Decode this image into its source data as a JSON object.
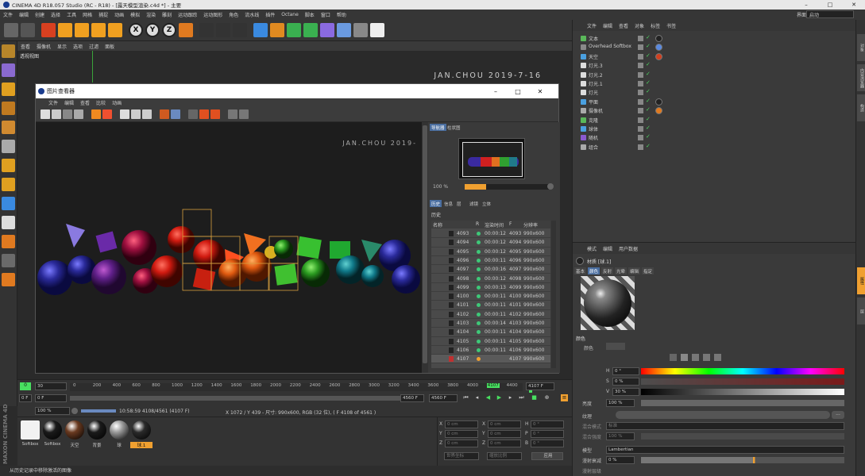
{
  "window": {
    "title": "CINEMA 4D R18.057 Studio (RC - R18) - [露天模型渲染.c4d *] - 主要",
    "minimize": "–",
    "maximize": "□",
    "close": "✕"
  },
  "menubar": {
    "items": [
      "文件",
      "编辑",
      "创建",
      "选择",
      "工具",
      "网格",
      "捕捉",
      "动画",
      "模拟",
      "渲染",
      "雕刻",
      "运动跟踪",
      "运动图形",
      "角色",
      "流水线",
      "插件",
      "Octane",
      "脚本",
      "窗口",
      "帮助"
    ],
    "layout_label": "界面:",
    "layout_value": "启动"
  },
  "toolbar": {
    "icons": [
      "undo-icon",
      "redo-icon",
      "select-icon",
      "move-icon",
      "scale-icon",
      "rotate-icon",
      "live-select-icon",
      "x-axis-icon",
      "y-axis-icon",
      "z-axis-icon",
      "coordinate-icon",
      "render-region-icon",
      "render-view-icon",
      "render-settings-icon",
      "cube-icon",
      "pen-icon",
      "subdivide-icon",
      "array-icon",
      "deformer-icon",
      "floor-icon",
      "camera-icon",
      "light-icon"
    ],
    "axis_x": "X",
    "axis_y": "Y",
    "axis_z": "Z"
  },
  "viewport": {
    "menu": [
      "查看",
      "摄像机",
      "显示",
      "选项",
      "过滤",
      "面板"
    ],
    "label": "透视视图",
    "watermark": "JAN.CHOU 2019-7-16"
  },
  "picture_viewer": {
    "title": "图片查看器",
    "menu": [
      "文件",
      "编辑",
      "查看",
      "比较",
      "动画"
    ],
    "watermark": "JAN.CHOU 2019-",
    "side_tabs": [
      "导航器",
      "柱状图"
    ],
    "zoom": "100 %",
    "zoom_fill": 0.25,
    "history_tabs": [
      "历史",
      "信息",
      "层",
      "滤镜",
      "立体"
    ],
    "history_label": "历史",
    "columns": [
      "名称",
      "R",
      "渲染时间",
      "F",
      "分辨率"
    ],
    "rows": [
      {
        "name": "4093",
        "time": "00:00:12",
        "f": "4093",
        "res": "990x600"
      },
      {
        "name": "4094",
        "time": "00:00:12",
        "f": "4094",
        "res": "990x600"
      },
      {
        "name": "4095",
        "time": "00:00:12",
        "f": "4095",
        "res": "990x600"
      },
      {
        "name": "4096",
        "time": "00:00:11",
        "f": "4096",
        "res": "990x600"
      },
      {
        "name": "4097",
        "time": "00:00:16",
        "f": "4097",
        "res": "990x600"
      },
      {
        "name": "4098",
        "time": "00:00:12",
        "f": "4098",
        "res": "990x600"
      },
      {
        "name": "4099",
        "time": "00:00:13",
        "f": "4099",
        "res": "990x600"
      },
      {
        "name": "4100",
        "time": "00:00:11",
        "f": "4100",
        "res": "990x600"
      },
      {
        "name": "4101",
        "time": "00:00:11",
        "f": "4101",
        "res": "990x600"
      },
      {
        "name": "4102",
        "time": "00:00:11",
        "f": "4102",
        "res": "990x600"
      },
      {
        "name": "4103",
        "time": "00:00:14",
        "f": "4103",
        "res": "990x600"
      },
      {
        "name": "4104",
        "time": "00:00:11",
        "f": "4104",
        "res": "990x600"
      },
      {
        "name": "4105",
        "time": "00:00:11",
        "f": "4105",
        "res": "990x600"
      },
      {
        "name": "4106",
        "time": "00:00:11",
        "f": "4106",
        "res": "990x600"
      },
      {
        "name": "4107",
        "time": "",
        "f": "4107",
        "res": "990x600"
      }
    ]
  },
  "status": {
    "zoom": "100 %",
    "timecode": "10:58:59 4108/4561 (4107 F)",
    "info": "X 1072 / Y 439 - 尺寸: 990x600, RGB (32 位), ( F 4108 of 4561 )"
  },
  "timeline": {
    "frame_start": "0",
    "ticks": [
      "0",
      "200",
      "400",
      "600",
      "800",
      "1000",
      "1200",
      "1400",
      "1600",
      "1800",
      "2000",
      "2200",
      "2400",
      "2600",
      "2800",
      "3000",
      "3200",
      "3400",
      "3600",
      "3800",
      "4000",
      "4107",
      "4400",
      "4600"
    ],
    "field_left": "30",
    "field_cur": "4107 F",
    "field_a": "0 F",
    "field_b": "0 F",
    "field_end": "4560 F",
    "field_end2": "4560 F"
  },
  "materials": [
    {
      "label": "Softbox",
      "color": "#f2f2f2"
    },
    {
      "label": "Softbox",
      "color": "#1a1a1a"
    },
    {
      "label": "天空",
      "color": "#6a3a20"
    },
    {
      "label": "背景",
      "color": "#1a1a1a"
    },
    {
      "label": "球",
      "color": "#999999"
    },
    {
      "label": "球.1",
      "color": "#2a2a2a"
    }
  ],
  "coords": {
    "rows": [
      {
        "a": "X",
        "av": "0 cm",
        "b": "X",
        "bv": "0 cm",
        "c": "H",
        "cv": "0 °"
      },
      {
        "a": "Y",
        "av": "0 cm",
        "b": "Y",
        "bv": "0 cm",
        "c": "P",
        "cv": "0 °"
      },
      {
        "a": "Z",
        "av": "0 cm",
        "b": "Z",
        "bv": "0 cm",
        "c": "B",
        "cv": "0 °"
      }
    ],
    "mode": "世界坐标",
    "scale": "缩放比例",
    "apply": "应用"
  },
  "bottom_status": "从历史记录中移除激活的图像",
  "objects": {
    "menu": [
      "文件",
      "编辑",
      "查看",
      "对象",
      "标签",
      "书签"
    ],
    "items": [
      {
        "name": "文本",
        "icon": "#5ab85a"
      },
      {
        "name": "Overhead Softbox",
        "icon": "#8a8a8a"
      },
      {
        "name": "天空",
        "icon": "#4aa0e0"
      },
      {
        "name": "灯光.3",
        "icon": "#dddddd"
      },
      {
        "name": "灯光.2",
        "icon": "#dddddd"
      },
      {
        "name": "灯光.1",
        "icon": "#dddddd"
      },
      {
        "name": "灯光",
        "icon": "#dddddd"
      },
      {
        "name": "平面",
        "icon": "#4aa0e0"
      },
      {
        "name": "摄像机",
        "icon": "#aaaaaa"
      },
      {
        "name": "克隆",
        "icon": "#5ab85a"
      },
      {
        "name": "球体",
        "icon": "#4aa0e0"
      },
      {
        "name": "随机",
        "icon": "#8a5ad0"
      },
      {
        "name": "组合",
        "icon": "#aaaaaa"
      }
    ]
  },
  "attributes": {
    "menu": [
      "模式",
      "编辑",
      "用户数据"
    ],
    "material_name": "材质 [球.1]",
    "tabs": [
      "基本",
      "颜色",
      "反射",
      "光晕",
      "编辑",
      "指定"
    ],
    "section": "颜色",
    "color_label": "颜色",
    "h_label": "H",
    "h_value": "0 °",
    "s_label": "S",
    "s_value": "0 %",
    "v_label": "V",
    "v_value": "30 %",
    "brightness_label": "亮度",
    "brightness_value": "100 %",
    "texture_label": "纹理",
    "mix_mode_label": "混合模式",
    "mix_mode_value": "标准",
    "mix_strength_label": "混合强度",
    "mix_strength_value": "100 %",
    "model_label": "模型",
    "model_value": "Lambertian",
    "diffuse_label": "漫射衰减",
    "diffuse_value": "0 %",
    "diffuse_level_label": "漫射层级"
  },
  "right_tabs": [
    "对象",
    "内容浏览器",
    "构造",
    "属性",
    "层"
  ]
}
